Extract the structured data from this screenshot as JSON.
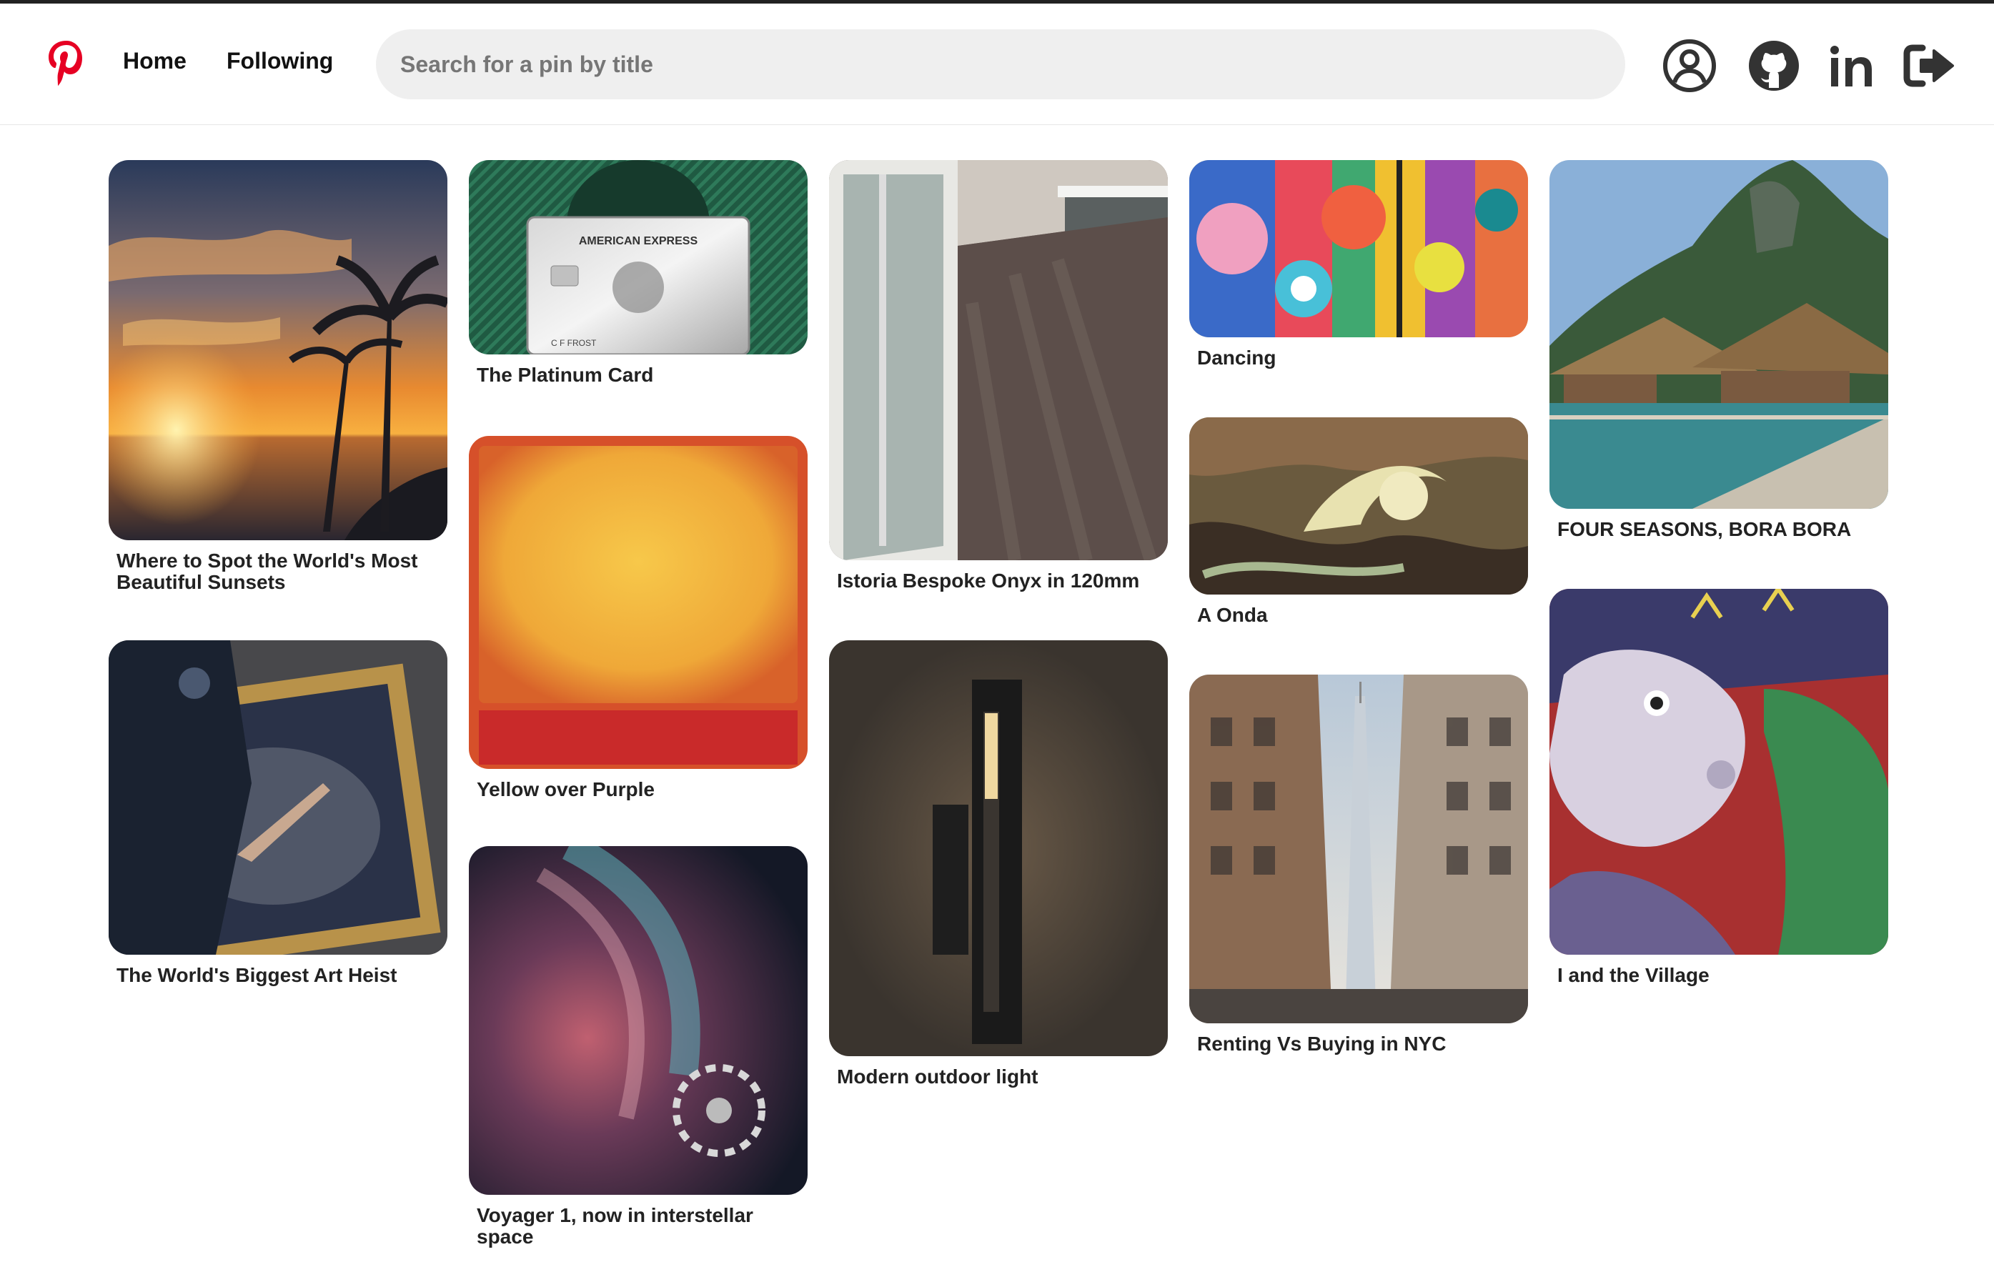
{
  "app": {
    "name": "Pinterest"
  },
  "nav": {
    "home_label": "Home",
    "following_label": "Following"
  },
  "search": {
    "placeholder": "Search for a pin by title",
    "value": ""
  },
  "header_icons": [
    "profile-icon",
    "github-icon",
    "linkedin-icon",
    "logout-icon"
  ],
  "colors": {
    "brand": "#e60023",
    "topbar": "#222222",
    "search_bg": "#efefef"
  },
  "pins": [
    {
      "title": "Where to Spot the World's Most Beautiful Sunsets",
      "image": "sunset-photo"
    },
    {
      "title": "The World's Biggest Art Heist",
      "image": "art-heist-photo"
    },
    {
      "title": "The Platinum Card",
      "image": "amex-card-photo",
      "card_text": "AMERICAN EXPRESS",
      "card_name": "C F FROST"
    },
    {
      "title": "Yellow over Purple",
      "image": "rothko-painting"
    },
    {
      "title": "Voyager 1, now in interstellar space",
      "image": "space-photo"
    },
    {
      "title": "Istoria Bespoke Onyx in 120mm",
      "image": "floor-photo"
    },
    {
      "title": "Modern outdoor light",
      "image": "wall-light-photo"
    },
    {
      "title": "Dancing",
      "image": "abstract-painting"
    },
    {
      "title": "A Onda",
      "image": "wave-painting"
    },
    {
      "title": "Renting Vs Buying in NYC",
      "image": "nyc-street-photo"
    },
    {
      "title": "FOUR SEASONS, BORA BORA",
      "image": "bora-bora-photo"
    },
    {
      "title": "I and the Village",
      "image": "chagall-painting"
    }
  ]
}
